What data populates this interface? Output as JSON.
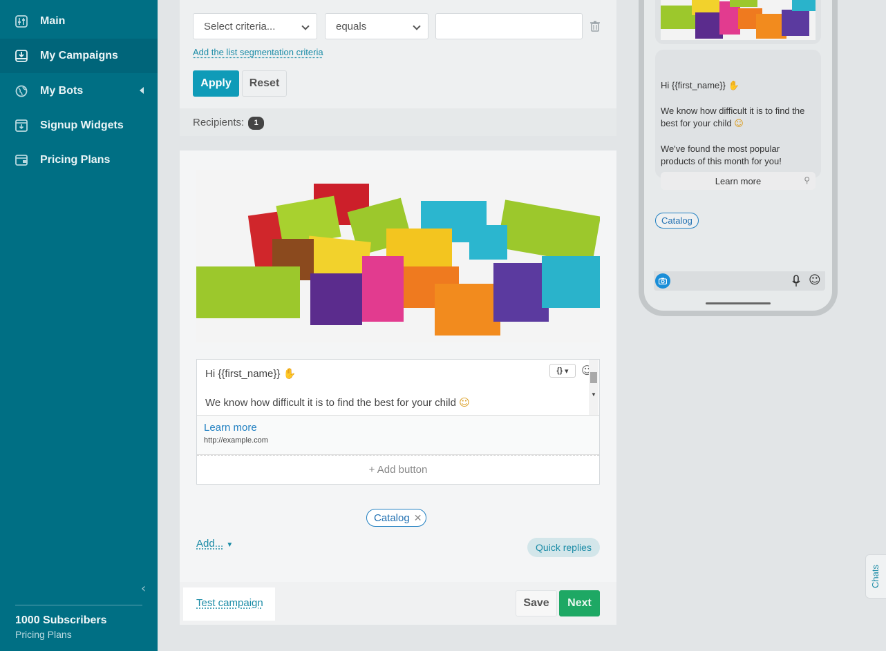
{
  "sidebar": {
    "items": [
      {
        "label": "Main",
        "icon": "sliders-icon"
      },
      {
        "label": "My Campaigns",
        "icon": "inbox-download-icon"
      },
      {
        "label": "My Bots",
        "icon": "globe-icon"
      },
      {
        "label": "Signup Widgets",
        "icon": "widget-download-icon"
      },
      {
        "label": "Pricing Plans",
        "icon": "wallet-icon"
      }
    ],
    "subscribers": "1000 Subscribers",
    "pricing_link": "Pricing Plans"
  },
  "filter": {
    "criteria_placeholder": "Select criteria...",
    "operator": "equals",
    "add_segmentation_link": "Add the list segmentation criteria",
    "apply_label": "Apply",
    "reset_label": "Reset",
    "recipients_label": "Recipients:",
    "recipients_count": "1"
  },
  "message": {
    "greeting": "Hi {{first_name}}",
    "body": "We know how difficult it is to find the best for your child",
    "button": {
      "label": "Learn more",
      "url": "http://example.com"
    },
    "add_button_label": "+ Add button",
    "quick_reply_chip": "Catalog",
    "add_menu_label": "Add...",
    "quick_replies_label": "Quick replies",
    "variables_label": "{}"
  },
  "footer": {
    "test_campaign": "Test campaign",
    "save_label": "Save",
    "next_label": "Next"
  },
  "preview": {
    "line1": "Hi {{first_name}}",
    "line2": "We know how difficult it is to find the best for your child",
    "line3": "We've found the most popular products of this month for you!",
    "button_label": "Learn more",
    "chip": "Catalog"
  },
  "chats_tab": "Chats",
  "colors": {
    "sidebar": "#006f84",
    "primary": "#0f9bb8",
    "next": "#1ea864",
    "link": "#1a8ba6"
  }
}
